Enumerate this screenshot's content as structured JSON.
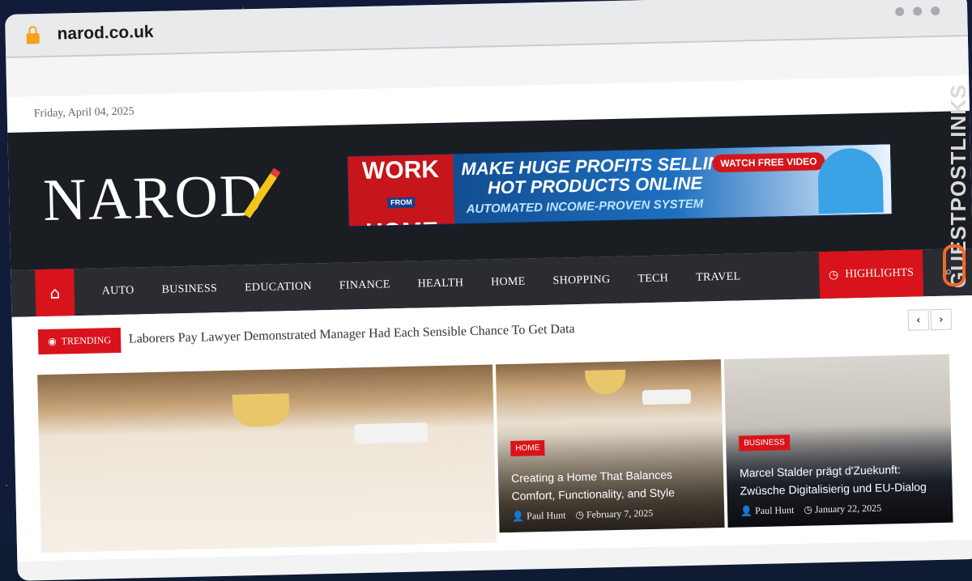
{
  "browser": {
    "url": "narod.co.uk"
  },
  "site": {
    "date": "Friday, April 04, 2025",
    "logo": "NAROD",
    "banner": {
      "work": "WORK",
      "from": "FROM",
      "home": "HOME",
      "line1": "MAKE HUGE PROFITS SELLING",
      "line2": "HOT PRODUCTS ONLINE",
      "line3": "AUTOMATED INCOME-PROVEN SYSTEM",
      "button": "WATCH FREE VIDEO"
    },
    "nav": [
      "AUTO",
      "BUSINESS",
      "EDUCATION",
      "FINANCE",
      "HEALTH",
      "HOME",
      "SHOPPING",
      "TECH",
      "TRAVEL"
    ],
    "highlights": "HIGHLIGHTS",
    "trending": {
      "label": "TRENDING",
      "headline": "Laborers Pay Lawyer Demonstrated Manager Had Each Sensible Chance To Get Data"
    },
    "cards": [
      {
        "tag": "HOME",
        "title": "Creating a Home That Balances Comfort, Functionality, and Style",
        "author": "Paul Hunt",
        "date": "February 7, 2025"
      },
      {
        "tag": "BUSINESS",
        "title": "Marcel Stalder prägt d'Zuekunft: Zwüsche Digitalisierig und EU-Dialog",
        "author": "Paul Hunt",
        "date": "January 22, 2025"
      }
    ]
  },
  "watermark": "GUESTPOSTLINKS"
}
